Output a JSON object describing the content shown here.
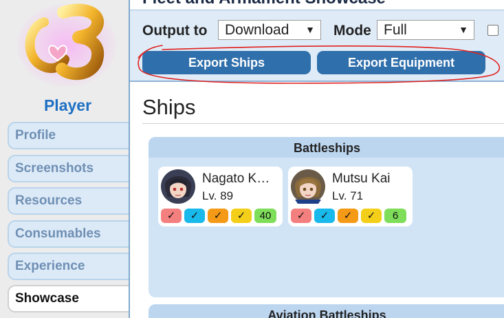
{
  "sidebar": {
    "title": "Player",
    "items": [
      {
        "label": "Profile",
        "active": false
      },
      {
        "label": "Screenshots",
        "active": false
      },
      {
        "label": "Resources",
        "active": false
      },
      {
        "label": "Consumables",
        "active": false
      },
      {
        "label": "Experience",
        "active": false
      },
      {
        "label": "Showcase",
        "active": true
      }
    ]
  },
  "header": {
    "title": "Fleet and Armament Showcase"
  },
  "controls": {
    "output_label": "Output to",
    "output_value": "Download",
    "mode_label": "Mode",
    "mode_value": "Full",
    "arrow": "▼",
    "export_ships": "Export Ships",
    "export_equipment": "Export Equipment"
  },
  "ships": {
    "heading": "Ships",
    "sections": [
      {
        "title": "Battleships",
        "cards": [
          {
            "name": "Nagato K…",
            "level": "Lv. 89",
            "badges": [
              "✓",
              "✓",
              "✓",
              "✓",
              "40"
            ]
          },
          {
            "name": "Mutsu Kai",
            "level": "Lv. 71",
            "badges": [
              "✓",
              "✓",
              "✓",
              "✓",
              "6"
            ]
          }
        ]
      },
      {
        "title": "Aviation Battleships"
      }
    ]
  },
  "colors": {
    "accent": "#2f6fab",
    "player_title": "#1e6fc4",
    "annotation": "#e0201c",
    "badge_colors": [
      "#f47f7f",
      "#19b9ec",
      "#f49a16",
      "#f4cf1a",
      "#7ede5a"
    ]
  }
}
